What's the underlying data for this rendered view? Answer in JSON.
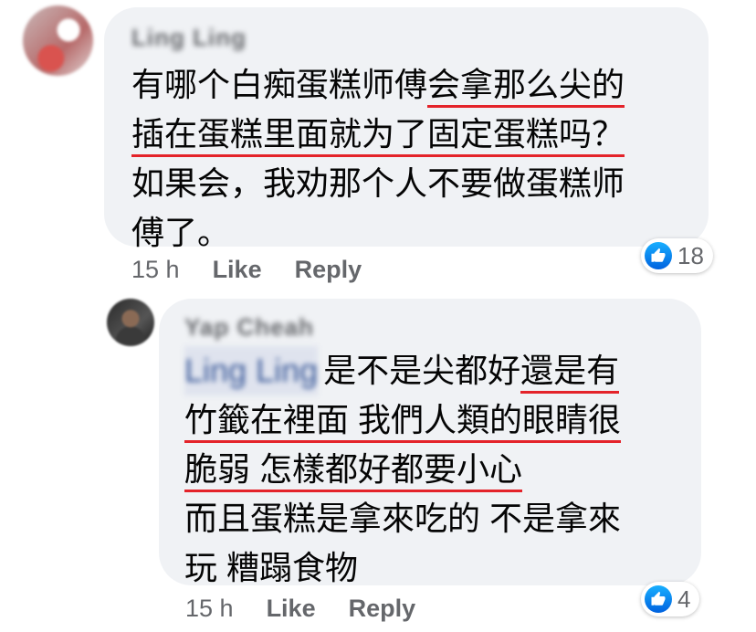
{
  "comments": [
    {
      "author": "Ling Ling",
      "lines": [
        {
          "parts": [
            {
              "t": "有哪个白痴蛋糕师傅",
              "u": false
            },
            {
              "t": "会拿那么尖的",
              "u": true
            }
          ]
        },
        {
          "parts": [
            {
              "t": "插在蛋糕里面就为了固定蛋糕吗？",
              "u": true
            }
          ]
        },
        {
          "parts": [
            {
              "t": "如果会，我劝那个人不要做蛋糕师",
              "u": false
            }
          ]
        },
        {
          "parts": [
            {
              "t": "傅了。",
              "u": false
            }
          ]
        }
      ],
      "time": "15 h",
      "like_label": "Like",
      "reply_label": "Reply",
      "reaction_icon": "like-icon",
      "reaction_count": "18"
    },
    {
      "author": "Yap Cheah",
      "mention": "Ling Ling",
      "lines": [
        {
          "parts": [
            {
              "t": "是不是尖都好",
              "u": false
            },
            {
              "t": "還是有",
              "u": true
            }
          ]
        },
        {
          "parts": [
            {
              "t": "竹籤在裡面 我們人類的眼睛很",
              "u": true
            }
          ]
        },
        {
          "parts": [
            {
              "t": "脆弱 怎樣都好都要小心",
              "u": true
            }
          ]
        },
        {
          "parts": [
            {
              "t": "而且蛋糕是拿來吃的 不是拿來",
              "u": false
            }
          ]
        },
        {
          "parts": [
            {
              "t": "玩 糟蹋食物",
              "u": false
            }
          ]
        }
      ],
      "time": "15 h",
      "like_label": "Like",
      "reply_label": "Reply",
      "reaction_icon": "like-icon",
      "reaction_count": "4"
    }
  ],
  "colors": {
    "bubble": "#f0f2f5",
    "underline": "#e4232a",
    "meta_text": "#65676b",
    "like_blue": "#1877f2"
  }
}
